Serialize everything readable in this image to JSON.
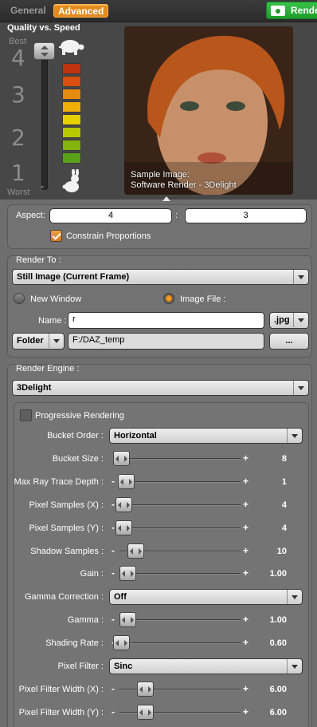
{
  "tabs": {
    "general": "General",
    "advanced": "Advanced"
  },
  "render_button": "Rende",
  "quality": {
    "title": "Quality vs. Speed",
    "best": "Best",
    "worst": "Worst",
    "levels": [
      "4",
      "3",
      "2",
      "1"
    ],
    "slider_level": 4,
    "dash": "-",
    "bar_colors": [
      "#c0330f",
      "#d75010",
      "#e58a10",
      "#f0b008",
      "#e7d000",
      "#b8c800",
      "#84b40c",
      "#5aa018"
    ]
  },
  "sample": {
    "caption_line1": "Sample Image:",
    "caption_line2": "Software Render - 3Delight"
  },
  "aspect": {
    "label": "Aspect:",
    "width": "4",
    "separator": ":",
    "height": "3",
    "constrain_label": "Constrain Proportions",
    "constrain_checked": true
  },
  "render_to": {
    "section_label": "Render To :",
    "mode": "Still Image (Current Frame)",
    "new_window": "New Window",
    "image_file": "Image File :",
    "selected": "Image File :",
    "name_label": "Name :",
    "name_value": "r",
    "ext": ".jpg",
    "folder_button": "Folder",
    "folder_path": "F:/DAZ_temp",
    "browse": "..."
  },
  "engine": {
    "section_label": "Render Engine :",
    "selected": "3Delight",
    "progressive_label": "Progressive Rendering",
    "progressive_checked": false
  },
  "settings": [
    {
      "label": "Bucket Order :",
      "type": "select",
      "value": "Horizontal"
    },
    {
      "label": "Bucket Size :",
      "type": "slider",
      "value": "8",
      "minus": "",
      "plus": "+",
      "position": 0.0
    },
    {
      "label": "Max Ray Trace Depth :",
      "type": "slider",
      "value": "1",
      "minus": "-",
      "plus": "+",
      "position": 0.04
    },
    {
      "label": "Pixel Samples (X) :",
      "type": "slider",
      "value": "4",
      "minus": "-",
      "plus": "+",
      "position": 0.02
    },
    {
      "label": "Pixel Samples (Y) :",
      "type": "slider",
      "value": "4",
      "minus": "-",
      "plus": "+",
      "position": 0.02
    },
    {
      "label": "Shadow Samples :",
      "type": "slider",
      "value": "10",
      "minus": "-",
      "plus": "+",
      "position": 0.12
    },
    {
      "label": "Gain :",
      "type": "slider",
      "value": "1.00",
      "minus": "-",
      "plus": "+",
      "position": 0.05
    },
    {
      "label": "Gamma Correction :",
      "type": "select",
      "value": "Off"
    },
    {
      "label": "Gamma :",
      "type": "slider",
      "value": "1.00",
      "minus": "-",
      "plus": "+",
      "position": 0.05
    },
    {
      "label": "Shading Rate :",
      "type": "slider",
      "value": "0.60",
      "minus": "-",
      "plus": "+",
      "position": 0.0
    },
    {
      "label": "Pixel Filter :",
      "type": "select",
      "value": "Sinc"
    },
    {
      "label": "Pixel Filter Width (X) :",
      "type": "slider",
      "value": "6.00",
      "minus": "-",
      "plus": "+",
      "position": 0.2
    },
    {
      "label": "Pixel Filter Width (Y) :",
      "type": "slider",
      "value": "6.00",
      "minus": "-",
      "plus": "+",
      "position": 0.2
    }
  ]
}
